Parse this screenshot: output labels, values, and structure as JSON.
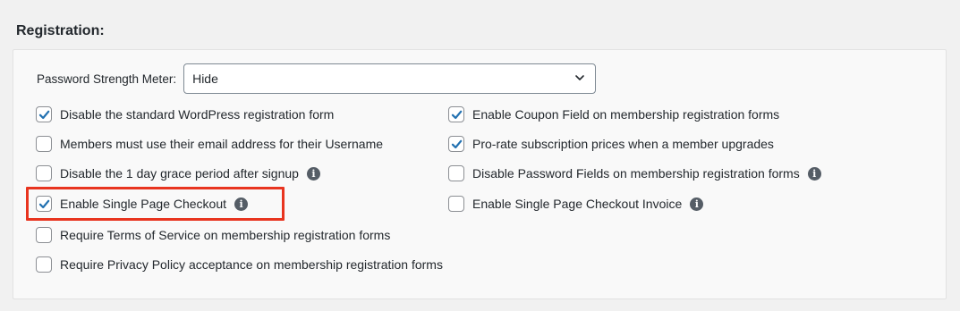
{
  "section": {
    "title": "Registration:"
  },
  "password_meter": {
    "label": "Password Strength Meter:",
    "value": "Hide"
  },
  "options_left": [
    {
      "label": "Disable the standard WordPress registration form",
      "checked": true,
      "info": false
    },
    {
      "label": "Members must use their email address for their Username",
      "checked": false,
      "info": false
    },
    {
      "label": "Disable the 1 day grace period after signup",
      "checked": false,
      "info": true
    },
    {
      "label": "Enable Single Page Checkout",
      "checked": true,
      "info": true
    },
    {
      "label": "Require Terms of Service on membership registration forms",
      "checked": false,
      "info": false
    },
    {
      "label": "Require Privacy Policy acceptance on membership registration forms",
      "checked": false,
      "info": false
    }
  ],
  "options_right": [
    {
      "label": "Enable Coupon Field on membership registration forms",
      "checked": true,
      "info": false
    },
    {
      "label": "Pro-rate subscription prices when a member upgrades",
      "checked": true,
      "info": false
    },
    {
      "label": "Disable Password Fields on membership registration forms",
      "checked": false,
      "info": true
    },
    {
      "label": "Enable Single Page Checkout Invoice",
      "checked": false,
      "info": true
    }
  ],
  "colors": {
    "accent": "#2271b1",
    "highlight": "#e8341f"
  },
  "icons": {
    "check": "checkmark-icon",
    "info": "info-icon",
    "dropdown": "chevron-down-icon"
  },
  "info_glyph": "i"
}
